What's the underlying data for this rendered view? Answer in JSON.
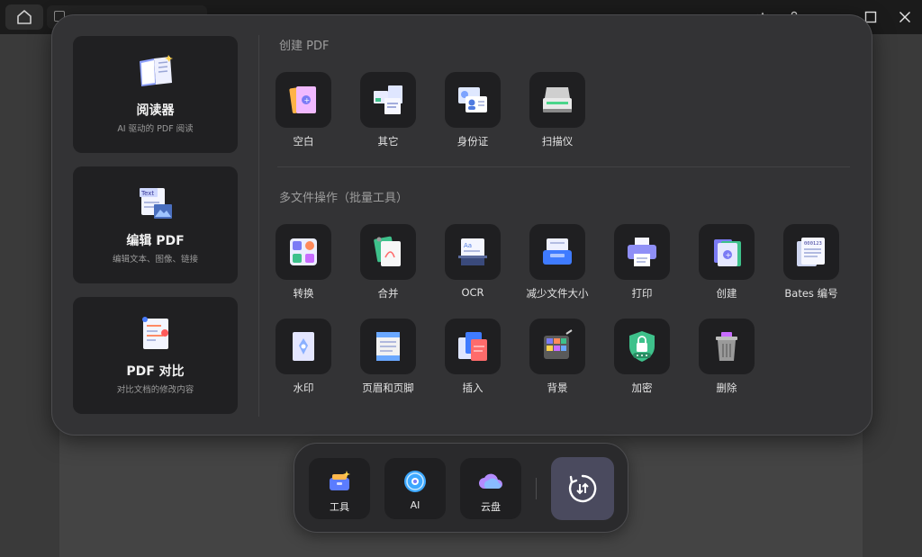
{
  "window": {
    "controls": [
      {
        "name": "crown-icon"
      },
      {
        "name": "user-icon"
      },
      {
        "name": "minimize-icon"
      },
      {
        "name": "maximize-icon"
      },
      {
        "name": "close-icon"
      }
    ]
  },
  "left_cards": [
    {
      "title": "阅读器",
      "subtitle": "AI 驱动的 PDF 阅读",
      "icon": "book-icon"
    },
    {
      "title": "编辑 PDF",
      "subtitle": "编辑文本、图像、链接",
      "icon": "edit-text-icon"
    },
    {
      "title": "PDF 对比",
      "subtitle": "对比文档的修改内容",
      "icon": "compare-icon"
    }
  ],
  "create_section": {
    "title": "创建 PDF",
    "tools": [
      {
        "label": "空白",
        "icon": "blank-pdf-icon"
      },
      {
        "label": "其它",
        "icon": "other-files-icon"
      },
      {
        "label": "身份证",
        "icon": "id-card-icon"
      },
      {
        "label": "扫描仪",
        "icon": "scanner-icon"
      }
    ]
  },
  "batch_section": {
    "title": "多文件操作（批量工具）",
    "tools": [
      {
        "label": "转换",
        "icon": "convert-icon"
      },
      {
        "label": "合并",
        "icon": "merge-icon"
      },
      {
        "label": "OCR",
        "icon": "ocr-icon"
      },
      {
        "label": "减少文件大小",
        "icon": "compress-icon"
      },
      {
        "label": "打印",
        "icon": "printer-icon"
      },
      {
        "label": "创建",
        "icon": "create-icon"
      },
      {
        "label": "Bates 编号",
        "icon": "bates-icon"
      },
      {
        "label": "水印",
        "icon": "watermark-icon"
      },
      {
        "label": "页眉和页脚",
        "icon": "header-footer-icon"
      },
      {
        "label": "插入",
        "icon": "insert-icon"
      },
      {
        "label": "背景",
        "icon": "background-icon"
      },
      {
        "label": "加密",
        "icon": "encrypt-icon"
      },
      {
        "label": "删除",
        "icon": "delete-icon"
      }
    ]
  },
  "dock": {
    "items": [
      {
        "label": "工具",
        "icon": "toolbox-icon"
      },
      {
        "label": "AI",
        "icon": "ai-orb-icon"
      },
      {
        "label": "云盘",
        "icon": "cloud-icon"
      }
    ],
    "switch_icon": "switch-arrows-icon"
  },
  "colors": {
    "panel_bg": "#333335",
    "tile_bg": "#1f1f21",
    "accent_purple": "#7b7bf5",
    "dock_switch_bg": "#4a4a5e"
  }
}
